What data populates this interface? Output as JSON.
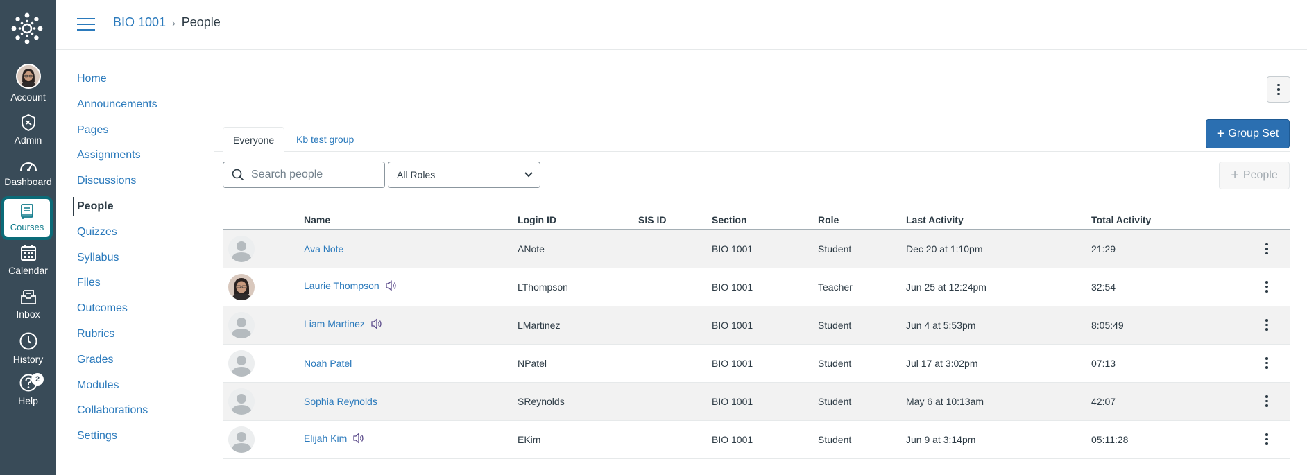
{
  "global_nav": {
    "items": [
      {
        "label": "Account"
      },
      {
        "label": "Admin"
      },
      {
        "label": "Dashboard"
      },
      {
        "label": "Courses"
      },
      {
        "label": "Calendar"
      },
      {
        "label": "Inbox"
      },
      {
        "label": "History"
      },
      {
        "label": "Help",
        "badge": "2"
      }
    ],
    "active": "Courses",
    "colors": {
      "background": "#394b58",
      "active_border": "#0b6b78"
    }
  },
  "breadcrumb": {
    "course": "BIO 1001",
    "page": "People"
  },
  "course_nav": {
    "items": [
      "Home",
      "Announcements",
      "Pages",
      "Assignments",
      "Discussions",
      "People",
      "Quizzes",
      "Syllabus",
      "Files",
      "Outcomes",
      "Rubrics",
      "Grades",
      "Modules",
      "Collaborations",
      "Settings"
    ],
    "active": "People"
  },
  "tabs": [
    {
      "label": "Everyone",
      "selected": true
    },
    {
      "label": "Kb test group",
      "selected": false
    }
  ],
  "buttons": {
    "group_set": "Group Set",
    "add_people": "People"
  },
  "search": {
    "placeholder": "Search people"
  },
  "role_filter": {
    "selected": "All Roles"
  },
  "table": {
    "headers": [
      "Name",
      "Login ID",
      "SIS ID",
      "Section",
      "Role",
      "Last Activity",
      "Total Activity"
    ],
    "rows": [
      {
        "name": "Ava Note",
        "login": "ANote",
        "sis": "",
        "section": "BIO 1001",
        "role": "Student",
        "last": "Dec 20 at 1:10pm",
        "total": "21:29",
        "avatar": "default-avatar",
        "pronunciation": false
      },
      {
        "name": "Laurie Thompson",
        "login": "LThompson",
        "sis": "",
        "section": "BIO 1001",
        "role": "Teacher",
        "last": "Jun 25 at 12:24pm",
        "total": "32:54",
        "avatar": "photo-avatar",
        "pronunciation": true
      },
      {
        "name": "Liam Martinez",
        "login": "LMartinez",
        "sis": "",
        "section": "BIO 1001",
        "role": "Student",
        "last": "Jun 4 at 5:53pm",
        "total": "8:05:49",
        "avatar": "default-avatar",
        "pronunciation": true
      },
      {
        "name": "Noah Patel",
        "login": "NPatel",
        "sis": "",
        "section": "BIO 1001",
        "role": "Student",
        "last": "Jul 17 at 3:02pm",
        "total": "07:13",
        "avatar": "default-avatar",
        "pronunciation": false
      },
      {
        "name": "Sophia Reynolds",
        "login": "SReynolds",
        "sis": "",
        "section": "BIO 1001",
        "role": "Student",
        "last": "May 6 at 10:13am",
        "total": "42:07",
        "avatar": "default-avatar",
        "pronunciation": false
      },
      {
        "name": "Elijah Kim",
        "login": "EKim",
        "sis": "",
        "section": "BIO 1001",
        "role": "Student",
        "last": "Jun 9 at 3:14pm",
        "total": "05:11:28",
        "avatar": "default-avatar",
        "pronunciation": true
      }
    ]
  },
  "colors": {
    "link": "#2b7abc",
    "primary_button": "#2b6fb1",
    "row_alt": "#f2f2f2",
    "text": "#2d3b45"
  }
}
